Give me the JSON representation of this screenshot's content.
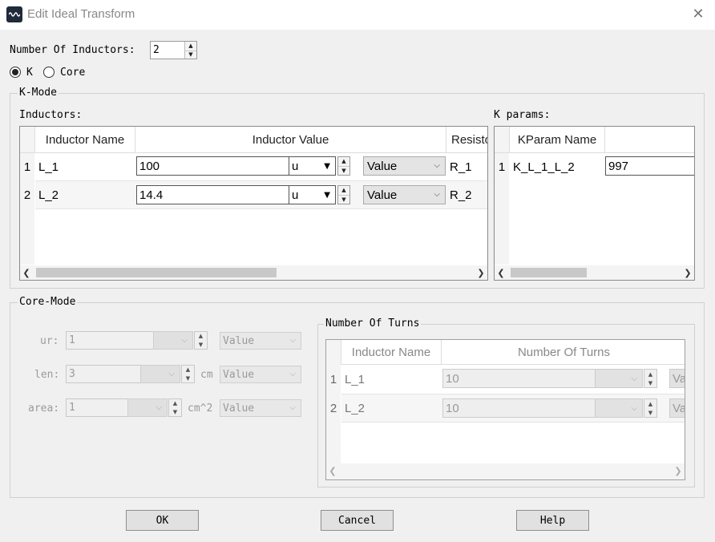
{
  "window": {
    "title": "Edit Ideal Transform",
    "close_symbol": "✕"
  },
  "top": {
    "num_inductors_label": "Number Of Inductors:",
    "num_inductors_value": "2",
    "radio_k_label": "K",
    "radio_core_label": "Core"
  },
  "kmode": {
    "legend": "K-Mode",
    "inductors_label": "Inductors:",
    "columns": {
      "name": "Inductor Name",
      "value": "Inductor Value",
      "resist": "Resisto"
    },
    "rows": [
      {
        "index": "1",
        "name": "L_1",
        "value": "100",
        "unit": "u",
        "mode": "Value",
        "resist": "R_1"
      },
      {
        "index": "2",
        "name": "L_2",
        "value": "14.4",
        "unit": "u",
        "mode": "Value",
        "resist": "R_2"
      }
    ],
    "kparams_label": "K params:",
    "kparams_columns": {
      "name": "KParam Name"
    },
    "kparams_rows": [
      {
        "index": "1",
        "name": "K_L_1_L_2",
        "value": "997"
      }
    ]
  },
  "coremode": {
    "legend": "Core-Mode",
    "ur_label": "ur:",
    "ur_value": "1",
    "ur_mode": "Value",
    "len_label": "len:",
    "len_value": "3",
    "len_unit": "cm",
    "len_mode": "Value",
    "area_label": "area:",
    "area_value": "1",
    "area_unit": "cm^2",
    "area_mode": "Value",
    "turns_legend": "Number Of Turns",
    "turns_columns": {
      "name": "Inductor Name",
      "turns": "Number Of Turns"
    },
    "turns_rows": [
      {
        "index": "1",
        "name": "L_1",
        "turns": "10",
        "mode": "Va"
      },
      {
        "index": "2",
        "name": "L_2",
        "turns": "10",
        "mode": "Va"
      }
    ]
  },
  "buttons": {
    "ok": "OK",
    "cancel": "Cancel",
    "help": "Help"
  }
}
